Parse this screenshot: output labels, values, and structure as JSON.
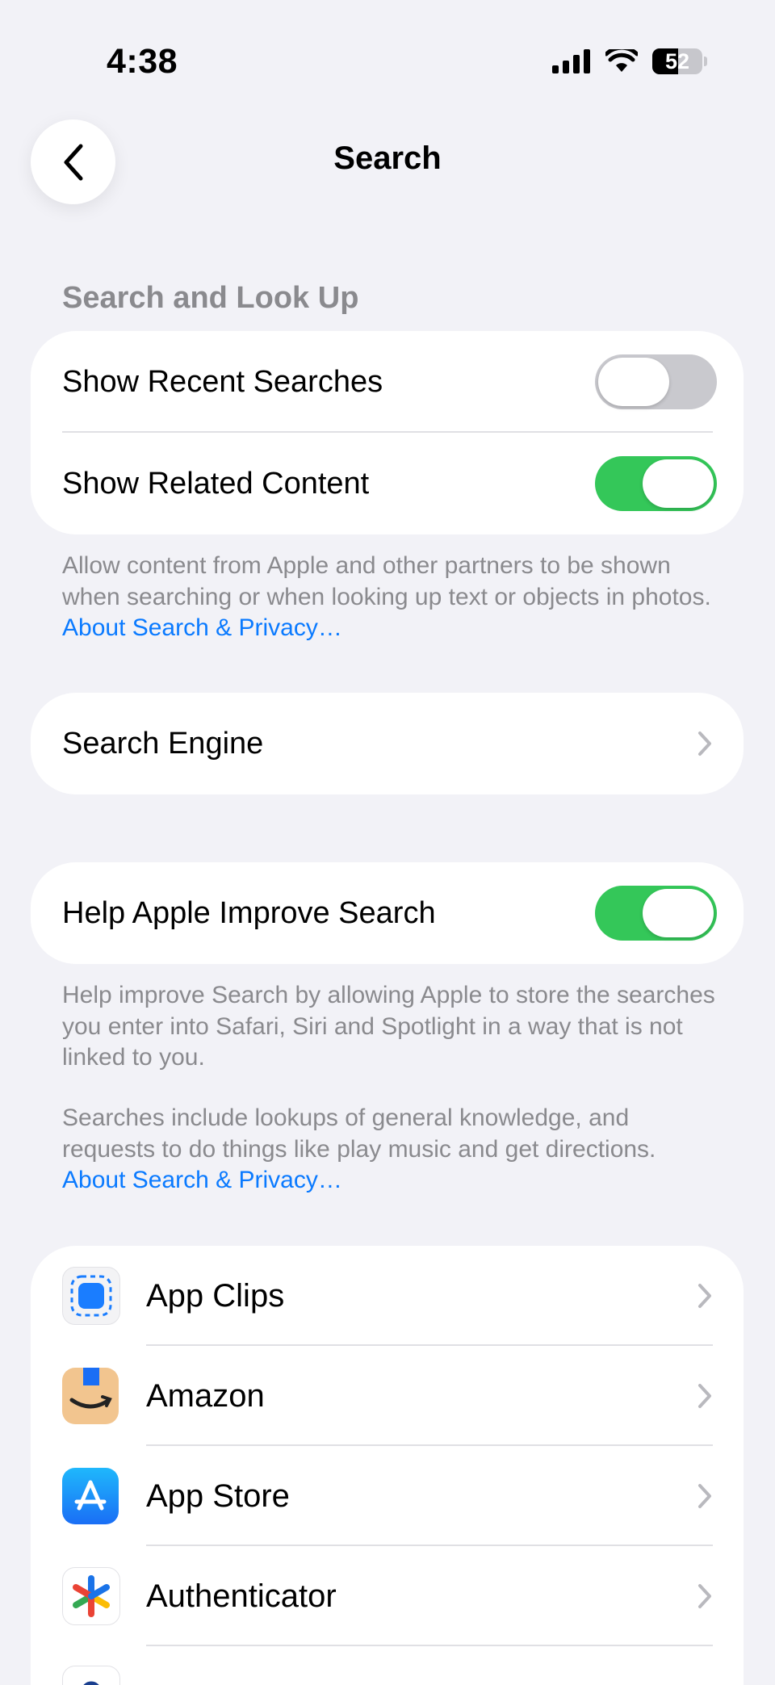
{
  "status_bar": {
    "time": "4:38",
    "battery_level": "52"
  },
  "nav": {
    "title": "Search",
    "back_icon": "chevron-left-icon"
  },
  "section_search_lookup": {
    "header": "Search and Look Up",
    "rows": [
      {
        "label": "Show Recent Searches",
        "toggle": "off"
      },
      {
        "label": "Show Related Content",
        "toggle": "on"
      }
    ],
    "footer_text": "Allow content from Apple and other partners to be shown when searching or when looking up text or objects in photos. ",
    "footer_link": "About Search & Privacy…"
  },
  "search_engine": {
    "label": "Search Engine"
  },
  "improve": {
    "label": "Help Apple Improve Search",
    "toggle": "on",
    "footer_text_1": "Help improve Search by allowing Apple to store the searches you enter into Safari, Siri and Spotlight in a way that is not linked to you.",
    "footer_text_2": "Searches include lookups of general knowledge, and requests to do things like play music and get directions.",
    "footer_link": "About Search & Privacy…"
  },
  "apps": [
    {
      "label": "App Clips",
      "icon": "app-clips-icon"
    },
    {
      "label": "Amazon",
      "icon": "amazon-icon"
    },
    {
      "label": "App Store",
      "icon": "app-store-icon"
    },
    {
      "label": "Authenticator",
      "icon": "authenticator-icon"
    }
  ],
  "colors": {
    "background": "#f2f2f7",
    "toggle_on": "#34c759",
    "link": "#0a7aff",
    "secondary_text": "#8a8a8e"
  }
}
